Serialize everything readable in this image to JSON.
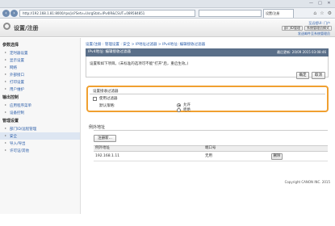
{
  "browser": {
    "url": "http://192.168.1.81:8000/rps/jsl?Setv=UsrgStat=IPv4IR&CSUT=089584851",
    "tab_title": "设置/注册",
    "window_buttons": [
      "—",
      "□",
      "✕"
    ]
  },
  "header": {
    "app_title": "设置/注册",
    "top_link": "至远程UI: 门户",
    "buttons": [
      "部门ID管理",
      "系统管理员模式"
    ],
    "bottom_link": "发送邮件至系统管理员"
  },
  "sidebar": {
    "groups": [
      {
        "title": "参数选择",
        "items": [
          "定时器设置",
          "显示设置",
          "网络",
          "外部接口",
          "打印设置",
          "用户维护"
        ]
      },
      {
        "title": "输出控制",
        "items": [
          "应用程序菜单",
          "设备控制"
        ]
      },
      {
        "title": "管理设置",
        "items": [
          "部门ID/远程管理",
          "安全",
          "导入/导出",
          "许可证/其他"
        ]
      }
    ],
    "active_item": "安全"
  },
  "main": {
    "breadcrumb": "设置/注册 : 管理设置 : 安全 > IP地址过滤器 > IPv4地址: 编辑接收过滤器",
    "panel_title": "IPv4地址: 编辑接收过滤器",
    "updated": "最后更新: 20/09 2015 03:08:46",
    "description": "设置和如下项目。(未标准的选项可不能\"打开\"后，重启生效。)",
    "ok_label": "确定",
    "cancel_label": "取消",
    "filter_section": {
      "title": "设置接收过滤器",
      "checkbox_label": "使用过滤器",
      "policy_label": "默认策略:",
      "radio_allow": "允许",
      "radio_deny": "拒绝",
      "selected": "允许"
    },
    "exception": {
      "title": "例外地址",
      "register_label": "注册新...",
      "columns": [
        "例外地址",
        "端口号"
      ],
      "rows": [
        {
          "address": "192.168.1.11",
          "port": "无用",
          "delete_label": "删除"
        }
      ]
    },
    "copyright": "Copyright CANON INC. 2015"
  }
}
